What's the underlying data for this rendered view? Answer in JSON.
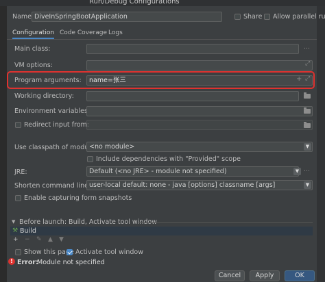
{
  "window": {
    "title": "Run/Debug Configurations"
  },
  "header": {
    "name_label": "Name:",
    "name_value": "DiveInSpringBootApplication",
    "share_label": "Share",
    "allow_parallel_label": "Allow parallel run"
  },
  "tabs": [
    {
      "label": "Configuration",
      "active": true
    },
    {
      "label": "Code Coverage",
      "active": false
    },
    {
      "label": "Logs",
      "active": false
    }
  ],
  "form": {
    "main_class_label": "Main class:",
    "main_class_value": "",
    "vm_options_label": "VM options:",
    "vm_options_value": "",
    "program_args_label": "Program arguments:",
    "program_args_value": "name=张三",
    "working_dir_label": "Working directory:",
    "working_dir_value": "",
    "env_vars_label": "Environment variables:",
    "env_vars_value": "",
    "redirect_input_label": "Redirect input from:",
    "redirect_input_value": "",
    "classpath_label": "Use classpath of module:",
    "classpath_value": "<no module>",
    "include_provided_label": "Include dependencies with \"Provided\" scope",
    "jre_label": "JRE:",
    "jre_value": "Default (<no JRE> - module not specified)",
    "shorten_label": "Shorten command line:",
    "shorten_value": "user-local default: none - java [options] classname [args]",
    "snapshots_label": "Enable capturing form snapshots"
  },
  "before_launch": {
    "header": "Before launch: Build, Activate tool window",
    "task": "Build",
    "show_page_label": "Show this page",
    "activate_tool_label": "Activate tool window"
  },
  "status": {
    "error_prefix": "Error:",
    "error_text": "Module not specified"
  },
  "buttons": {
    "cancel": "Cancel",
    "apply": "Apply",
    "ok": "OK"
  },
  "colors": {
    "background": "#3c3f41",
    "field": "#45494a",
    "accent": "#4a88c7",
    "highlight_box": "#e0322f",
    "error": "#e0322f"
  }
}
